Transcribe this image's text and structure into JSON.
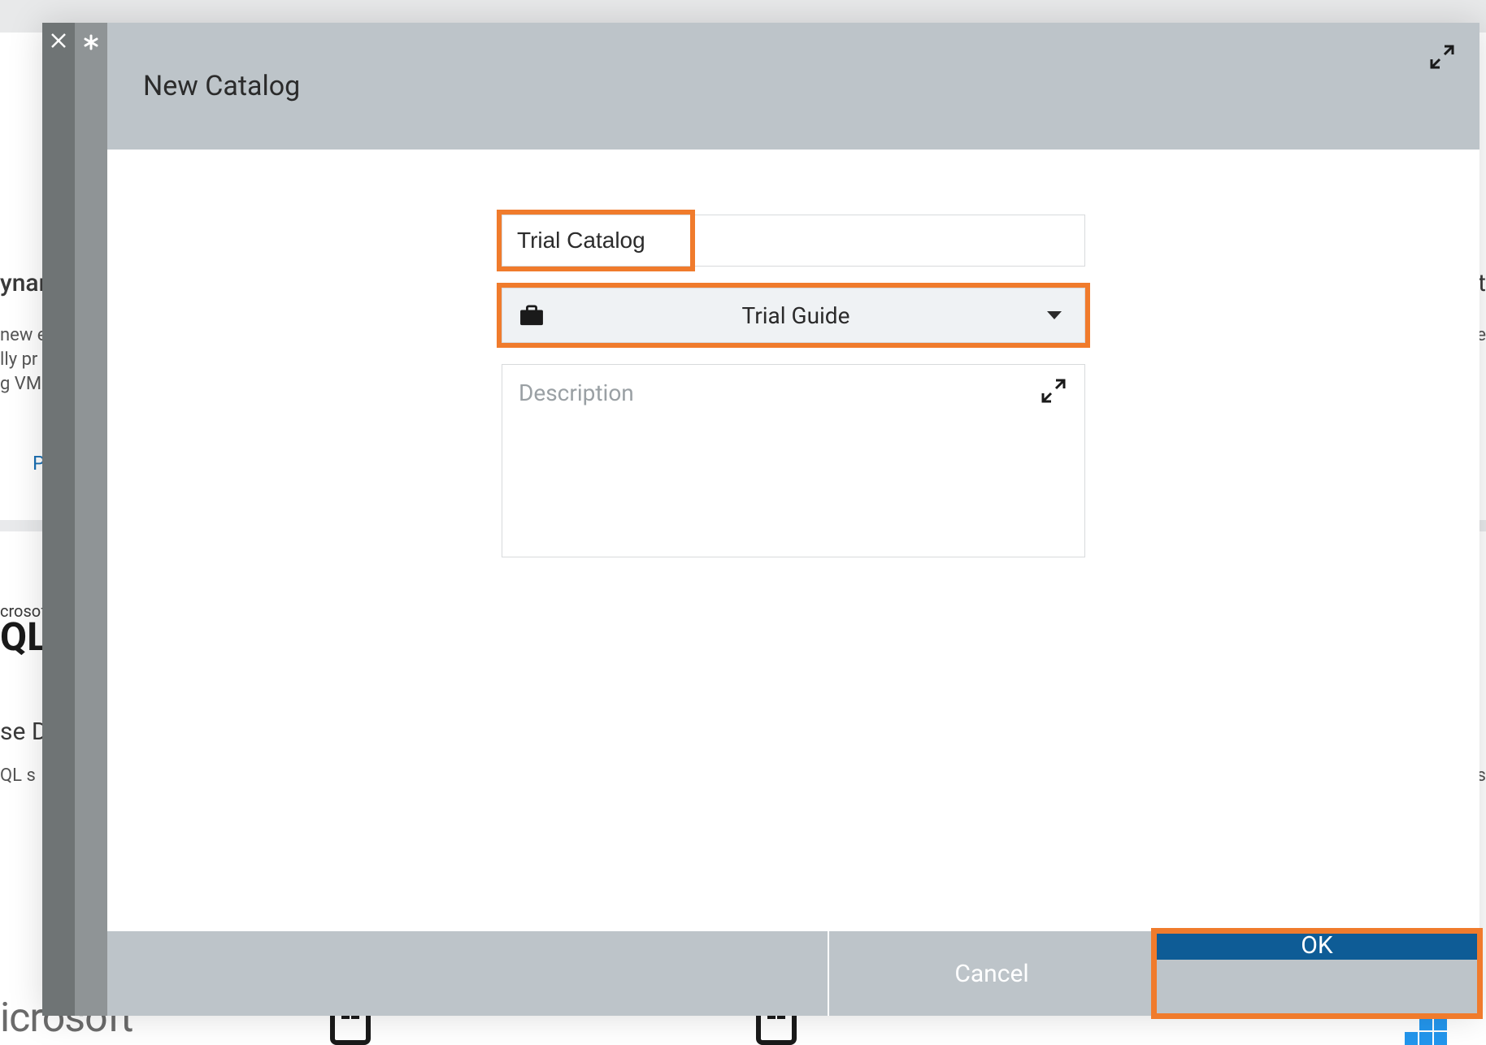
{
  "modal": {
    "title": "New Catalog",
    "name_value": "Trial Catalog",
    "business_unit_selected": "Trial Guide",
    "description_placeholder": "Description",
    "cancel_label": "Cancel",
    "ok_label": "OK"
  },
  "background": {
    "left_heading_frag": "ynar",
    "left_line1": "new e",
    "left_line2": "lly pr",
    "left_line3": "g VM",
    "left_link_frag": "P",
    "microsoft_small": "crosof",
    "sql_frag": "QL",
    "se_d": "se D",
    "sql_s": "QL s",
    "right_frag1": "nent",
    "right_frag2": "m file",
    "right_frag3": "n as",
    "microsoft_word": "icrosoft"
  }
}
